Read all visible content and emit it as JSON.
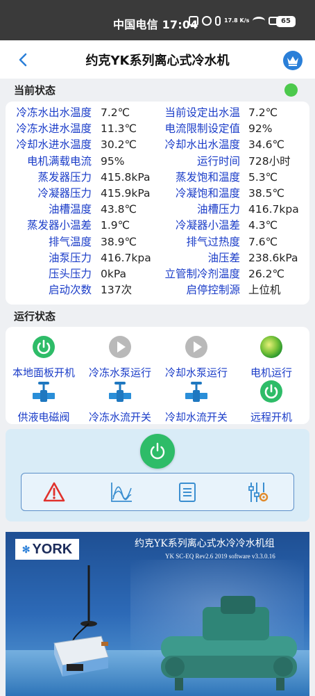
{
  "status_bar": {
    "carrier_time": "中国电信 17:04",
    "net_speed": "17.8 K/s",
    "battery": "65"
  },
  "header": {
    "title": "约克YK系列离心式冷水机"
  },
  "current_status": {
    "title": "当前状态",
    "indicator_color": "#4cc94c",
    "rows": [
      {
        "l1": "冷冻水出水温度",
        "v1": "7.2℃",
        "l2": "当前设定出水温",
        "v2": "7.2℃"
      },
      {
        "l1": "冷冻水进水温度",
        "v1": "11.3℃",
        "l2": "电流限制设定值",
        "v2": "92%"
      },
      {
        "l1": "冷却水进水温度",
        "v1": "30.2℃",
        "l2": "冷却水出水温度",
        "v2": "34.6℃"
      },
      {
        "l1": "电机满载电流",
        "v1": "95%",
        "l2": "运行时间",
        "v2": "728小时"
      },
      {
        "l1": "蒸发器压力",
        "v1": "415.8kPa",
        "l2": "蒸发饱和温度",
        "v2": "5.3℃"
      },
      {
        "l1": "冷凝器压力",
        "v1": "415.9kPa",
        "l2": "冷凝饱和温度",
        "v2": "38.5℃"
      },
      {
        "l1": "油槽温度",
        "v1": "43.8℃",
        "l2": "油槽压力",
        "v2": "416.7kpa"
      },
      {
        "l1": "蒸发器小温差",
        "v1": "1.9℃",
        "l2": "冷凝器小温差",
        "v2": "4.3℃"
      },
      {
        "l1": "排气温度",
        "v1": "38.9℃",
        "l2": "排气过热度",
        "v2": "7.6℃"
      },
      {
        "l1": "油泵压力",
        "v1": "416.7kpa",
        "l2": "油压差",
        "v2": "238.6kPa"
      },
      {
        "l1": "压头压力",
        "v1": "0kPa",
        "l2": "立管制冷剂温度",
        "v2": "26.2℃"
      },
      {
        "l1": "启动次数",
        "v1": "137次",
        "l2": "启停控制源",
        "v2": "上位机"
      }
    ]
  },
  "run_status": {
    "title": "运行状态",
    "items": [
      {
        "label": "本地面板开机",
        "icon": "power-icon"
      },
      {
        "label": "冷冻水泵运行",
        "icon": "play-icon"
      },
      {
        "label": "冷却水泵运行",
        "icon": "play-icon"
      },
      {
        "label": "电机运行",
        "icon": "motor-icon"
      },
      {
        "label": "供液电磁阀",
        "icon": "valve-icon"
      },
      {
        "label": "冷冻水流开关",
        "icon": "valve-icon"
      },
      {
        "label": "冷却水流开关",
        "icon": "valve-icon"
      },
      {
        "label": "远程开机",
        "icon": "power-icon"
      }
    ]
  },
  "banner": {
    "logo": "YORK",
    "title": "约克YK系列离心式水冷冷水机组",
    "subtitle": "YK SC-EQ Rev2.6 2019 software v3.3.0.16"
  }
}
